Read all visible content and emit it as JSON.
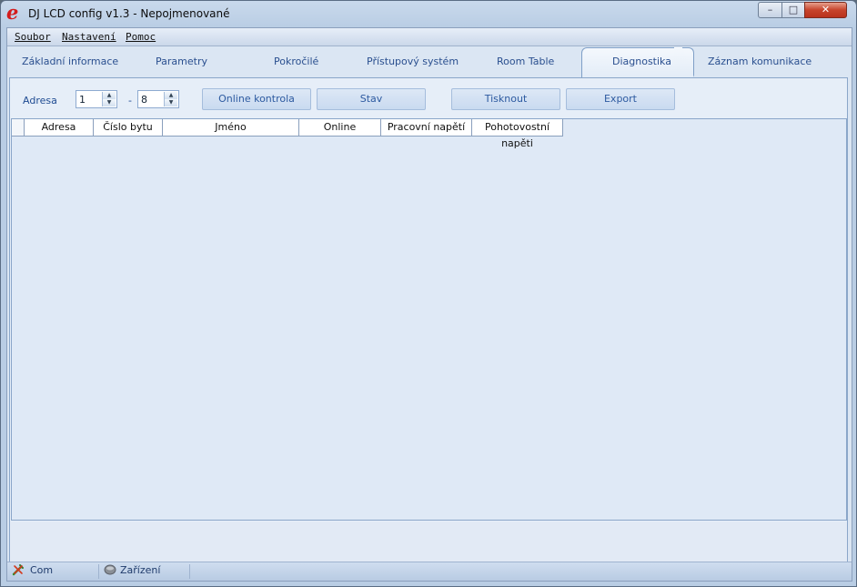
{
  "window": {
    "title": "DJ LCD config v1.3 - Nepojmenované",
    "logo_letter": "e"
  },
  "window_controls": {
    "minimize": "–",
    "maximize": "□",
    "close": "✕"
  },
  "menu": [
    "Soubor",
    "Nastavení",
    "Pomoc"
  ],
  "tabs": [
    {
      "label": "Základní informace",
      "active": false
    },
    {
      "label": "Parametry",
      "active": false
    },
    {
      "label": "Pokročilé",
      "active": false
    },
    {
      "label": "Přístupový systém",
      "active": false
    },
    {
      "label": "Room Table",
      "active": false
    },
    {
      "label": "Diagnostika",
      "active": true
    },
    {
      "label": "Záznam komunikace",
      "active": false
    }
  ],
  "toolbar": {
    "address_label": "Adresa",
    "from_value": "1",
    "separator": "-",
    "to_value": "8",
    "online_check": "Online kontrola",
    "status": "Stav",
    "print": "Tisknout",
    "export": "Export"
  },
  "table": {
    "columns": [
      "Adresa",
      "Číslo bytu",
      "Jméno",
      "Online",
      "Pracovní napětí",
      "Pohotovostní napěti"
    ],
    "rows": []
  },
  "statusbar": {
    "com_label": "Com",
    "com_icon": "disconnected-plug-icon",
    "device_label": "Zařízení",
    "device_icon": "device-icon"
  },
  "colors": {
    "accent_text": "#2d5aa0",
    "window_bg": "#b9cde4",
    "close_red": "#c7432b"
  }
}
